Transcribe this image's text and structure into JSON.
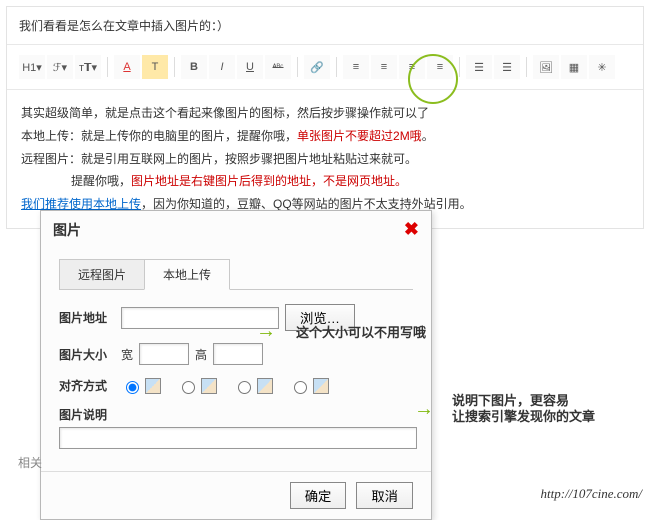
{
  "title": "我们看看是怎么在文章中插入图片的：）",
  "toolbar": {
    "h1": "H1▾",
    "font": "ℱ▾",
    "size": "т𝗧▾",
    "color": "A",
    "highlight": "T",
    "bold": "B",
    "italic": "I",
    "underline": "U",
    "strike": "ᴬᴮᶜ",
    "link": "🔗",
    "align_l": "≡",
    "align_c": "≡",
    "align_r": "≡",
    "align_j": "≡",
    "ol": "☰",
    "ul": "☰",
    "image": "🖼",
    "video": "▦",
    "other": "✳"
  },
  "body": {
    "l1a": "其实超级简单，就是点击这个看起来像图片的图标，然后按步骤操作就可以了",
    "l2a": "本地上传：就是上传你的电脑里的图片，提醒你哦，",
    "l2b": "单张图片不要超过2M哦",
    "l2c": "。",
    "l3": "远程图片：就是引用互联网上的图片，按照步骤把图片地址粘贴过来就可。",
    "l4a": "提醒你哦，",
    "l4b": "图片地址是右键图片后得到的地址，不是网页地址。",
    "l5a": "我们推荐使用本地上传",
    "l5b": "，因为你知道的，豆瓣、QQ等网站的图片不太支持外站引用。"
  },
  "dialog": {
    "title": "图片",
    "tab_remote": "远程图片",
    "tab_local": "本地上传",
    "addr_label": "图片地址",
    "browse": "浏览…",
    "size_label": "图片大小",
    "width": "宽",
    "height": "高",
    "align_label": "对齐方式",
    "desc_label": "图片说明",
    "ok": "确定",
    "cancel": "取消"
  },
  "notes": {
    "size": "这个大小可以不用写哦",
    "desc1": "说明下图片，更容易",
    "desc2": "让搜索引擎发现你的文章"
  },
  "side_label": "相关",
  "footer": "http://107cine.com/"
}
